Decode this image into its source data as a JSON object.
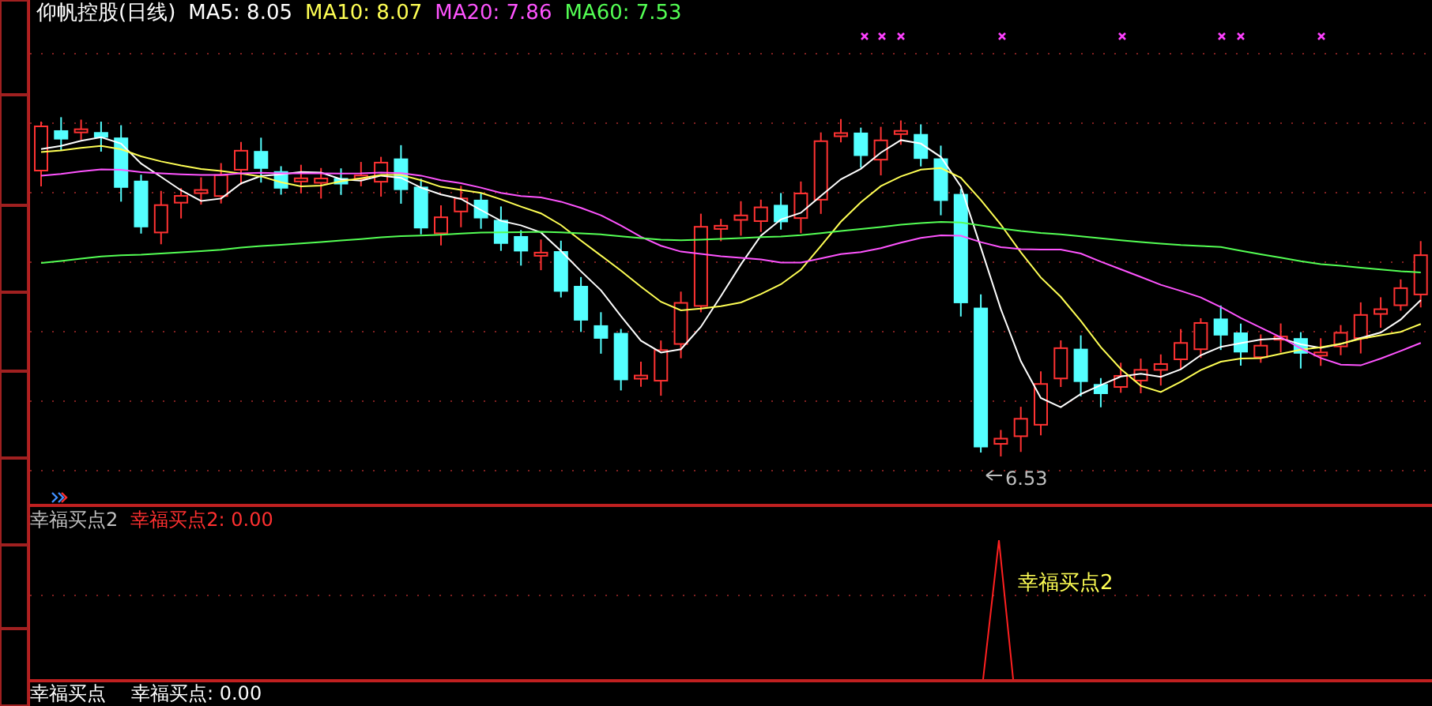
{
  "header": {
    "name": "仰帆控股(日线)",
    "indicators": [
      {
        "label": "MA5: 8.05",
        "color": "#ffffff"
      },
      {
        "label": "MA10: 8.07",
        "color": "#ffff54"
      },
      {
        "label": "MA20: 7.86",
        "color": "#ff54ff"
      },
      {
        "label": "MA60: 7.53",
        "color": "#54ff54"
      }
    ]
  },
  "low_marker": "6.53",
  "signal_panel": {
    "title": "幸福买点2",
    "reading": "幸福买点2: 0.00",
    "signal_label": "幸福买点2"
  },
  "bottom_panel": {
    "title": "幸福买点",
    "reading": "幸福买点: 0.00"
  }
}
